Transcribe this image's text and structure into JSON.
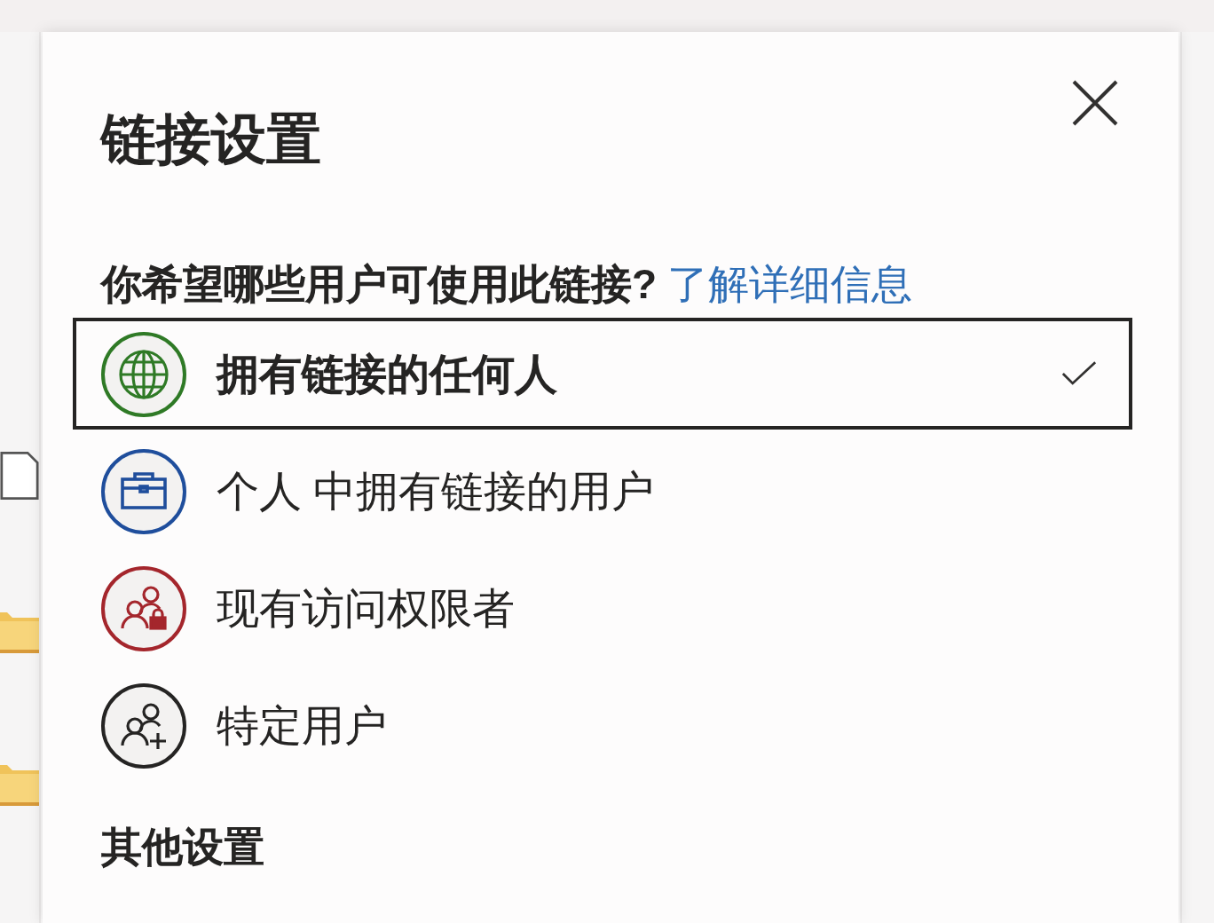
{
  "dialog": {
    "title": "链接设置",
    "question": "你希望哪些用户可使用此链接?",
    "learn_more_link": "了解详细信息",
    "options": [
      {
        "kind": "globe",
        "label": "拥有链接的任何人",
        "selected": true,
        "color": "#2f7a26"
      },
      {
        "kind": "briefcase",
        "label": "个人 中拥有链接的用户",
        "selected": false,
        "color": "#1f4e9c"
      },
      {
        "kind": "people-lock",
        "label": "现有访问权限者",
        "selected": false,
        "color": "#a4262c"
      },
      {
        "kind": "people-add",
        "label": "特定用户",
        "selected": false,
        "color": "#252423"
      }
    ],
    "section_heading": "其他设置"
  }
}
